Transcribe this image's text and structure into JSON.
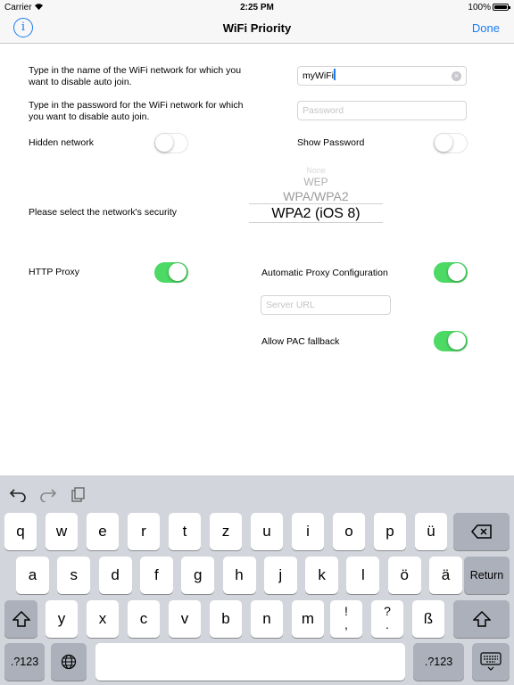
{
  "status_bar": {
    "carrier": "Carrier",
    "time": "2:25 PM",
    "battery": "100%"
  },
  "nav": {
    "title": "WiFi Priority",
    "done_label": "Done",
    "info_icon": "i"
  },
  "form": {
    "ssid_label": "Type in the name of the WiFi network for which you want to disable auto join.",
    "ssid_value": "myWiFi",
    "password_label": "Type in the password for the WiFi network for which you want to disable auto join.",
    "password_placeholder": "Password",
    "hidden_label": "Hidden network",
    "hidden_on": false,
    "show_password_label": "Show Password",
    "show_password_on": false,
    "security_label": "Please select the network's security",
    "security_options": [
      "None",
      "WEP",
      "WPA/WPA2",
      "WPA2 (iOS 8)"
    ],
    "security_selected": "WPA2 (iOS 8)",
    "http_proxy_label": "HTTP Proxy",
    "http_proxy_on": true,
    "auto_proxy_label": "Automatic Proxy Configuration",
    "auto_proxy_on": true,
    "server_url_placeholder": "Server URL",
    "pac_fallback_label": "Allow PAC fallback",
    "pac_fallback_on": true
  },
  "keyboard": {
    "row1": [
      "q",
      "w",
      "e",
      "r",
      "t",
      "z",
      "u",
      "i",
      "o",
      "p",
      "ü"
    ],
    "row2": [
      "a",
      "s",
      "d",
      "f",
      "g",
      "h",
      "j",
      "k",
      "l",
      "ö",
      "ä"
    ],
    "row3": [
      "y",
      "x",
      "c",
      "v",
      "b",
      "n",
      "m",
      "ß"
    ],
    "comma_top": "!",
    "comma_bottom": ",",
    "question_top": "?",
    "question_bottom": ".",
    "return_label": "Return",
    "numbers_label": ".?123",
    "icons": [
      "undo-icon",
      "redo-icon",
      "paste-icon",
      "backspace-icon",
      "shift-icon",
      "globe-icon",
      "keyboard-dismiss-icon"
    ]
  },
  "colors": {
    "accent": "#1a7cf5",
    "switch_on": "#4cd964",
    "keyboard_bg": "#d2d5db"
  }
}
